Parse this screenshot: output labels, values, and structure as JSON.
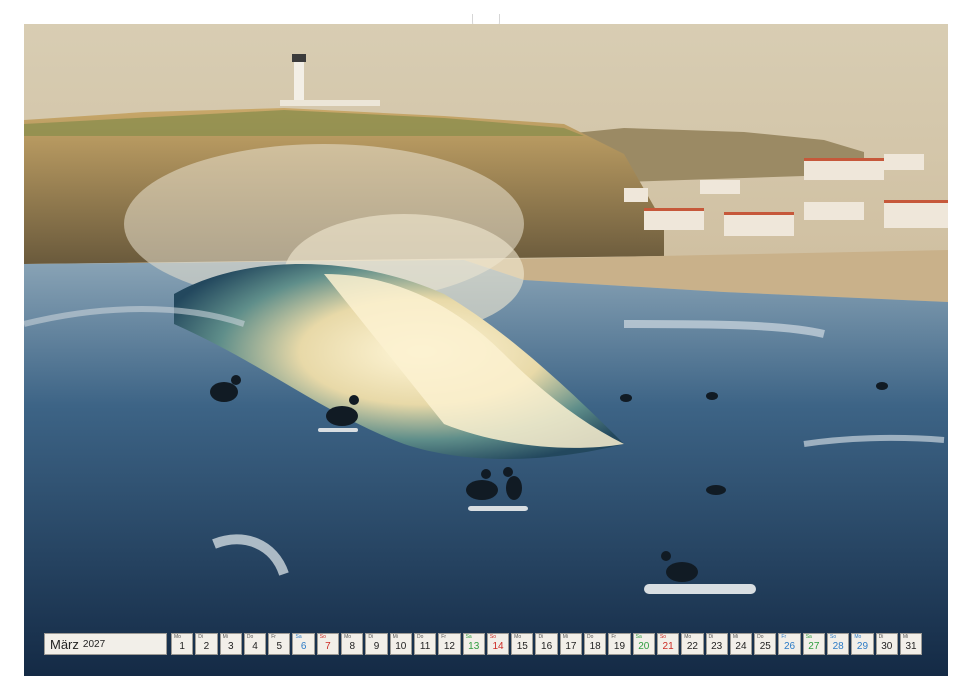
{
  "calendar": {
    "month": "März",
    "year": "2027",
    "days": [
      {
        "dow": "Mo",
        "num": "1",
        "kind": "weekday"
      },
      {
        "dow": "Di",
        "num": "2",
        "kind": "weekday"
      },
      {
        "dow": "Mi",
        "num": "3",
        "kind": "weekday"
      },
      {
        "dow": "Do",
        "num": "4",
        "kind": "weekday"
      },
      {
        "dow": "Fr",
        "num": "5",
        "kind": "weekday"
      },
      {
        "dow": "Sa",
        "num": "6",
        "kind": "sat"
      },
      {
        "dow": "So",
        "num": "7",
        "kind": "sun"
      },
      {
        "dow": "Mo",
        "num": "8",
        "kind": "weekday"
      },
      {
        "dow": "Di",
        "num": "9",
        "kind": "weekday"
      },
      {
        "dow": "Mi",
        "num": "10",
        "kind": "weekday"
      },
      {
        "dow": "Do",
        "num": "11",
        "kind": "weekday"
      },
      {
        "dow": "Fr",
        "num": "12",
        "kind": "weekday"
      },
      {
        "dow": "Sa",
        "num": "13",
        "kind": "hol"
      },
      {
        "dow": "So",
        "num": "14",
        "kind": "sun"
      },
      {
        "dow": "Mo",
        "num": "15",
        "kind": "weekday"
      },
      {
        "dow": "Di",
        "num": "16",
        "kind": "weekday"
      },
      {
        "dow": "Mi",
        "num": "17",
        "kind": "weekday"
      },
      {
        "dow": "Do",
        "num": "18",
        "kind": "weekday"
      },
      {
        "dow": "Fr",
        "num": "19",
        "kind": "weekday"
      },
      {
        "dow": "Sa",
        "num": "20",
        "kind": "hol"
      },
      {
        "dow": "So",
        "num": "21",
        "kind": "sun"
      },
      {
        "dow": "Mo",
        "num": "22",
        "kind": "weekday"
      },
      {
        "dow": "Di",
        "num": "23",
        "kind": "weekday"
      },
      {
        "dow": "Mi",
        "num": "24",
        "kind": "weekday"
      },
      {
        "dow": "Do",
        "num": "25",
        "kind": "weekday"
      },
      {
        "dow": "Fr",
        "num": "26",
        "kind": "sat"
      },
      {
        "dow": "Sa",
        "num": "27",
        "kind": "hol"
      },
      {
        "dow": "So",
        "num": "28",
        "kind": "sat"
      },
      {
        "dow": "Mo",
        "num": "29",
        "kind": "sat"
      },
      {
        "dow": "Di",
        "num": "30",
        "kind": "weekday"
      },
      {
        "dow": "Mi",
        "num": "31",
        "kind": "weekday"
      }
    ]
  },
  "colors": {
    "saturday": "#2c7bc6",
    "sunday": "#cc2a24",
    "holiday": "#2f9e3f"
  },
  "photo": {
    "icons": [
      "lighthouse-icon",
      "surfer-icon"
    ]
  }
}
